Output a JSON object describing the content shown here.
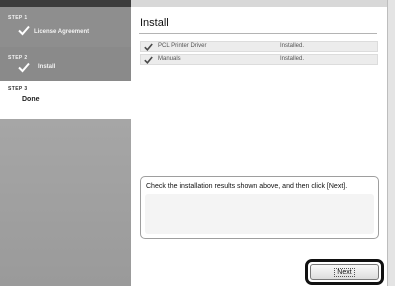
{
  "sidebar": {
    "steps": [
      {
        "label": "STEP 1",
        "title": "License Agreement",
        "state": "completed",
        "icon": "checkmark-icon"
      },
      {
        "label": "STEP 2",
        "title": "Install",
        "state": "completed",
        "icon": "checkmark-icon"
      },
      {
        "label": "STEP 3",
        "title": "Done",
        "state": "current"
      }
    ]
  },
  "main": {
    "title": "Install",
    "items": [
      {
        "name": "PCL Printer Driver",
        "status": "Installed.",
        "icon": "checkmark-icon"
      },
      {
        "name": "Manuals",
        "status": "Installed.",
        "icon": "checkmark-icon"
      }
    ],
    "message": "Check the installation results shown above, and then click [Next]."
  },
  "footer": {
    "next_label": "Next"
  },
  "colors": {
    "sidebar": "#9a9a9a",
    "sidebar_active": "#ffffff",
    "highlight_ring": "#111111"
  }
}
